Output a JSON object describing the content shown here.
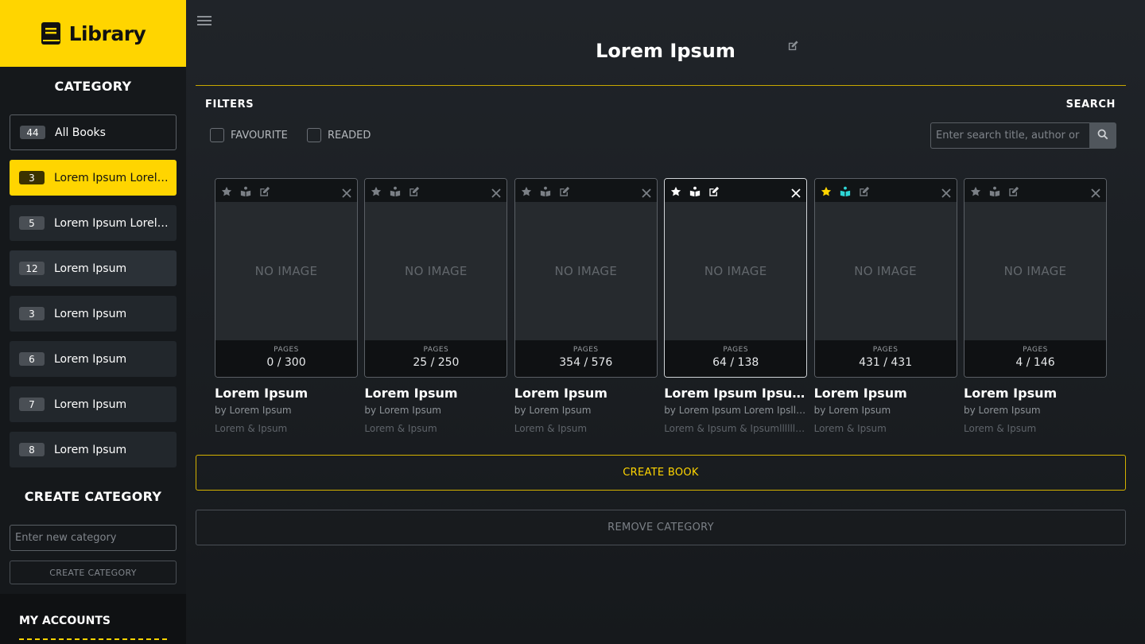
{
  "brand": {
    "title": "Library"
  },
  "sidebar": {
    "category_heading": "CATEGORY",
    "categories": [
      {
        "count": "44",
        "label": "All Books",
        "state": "outlined"
      },
      {
        "count": "3",
        "label": "Lorem Ipsum Lorelllll",
        "state": "active"
      },
      {
        "count": "5",
        "label": "Lorem Ipsum Lorelllll",
        "state": "normal"
      },
      {
        "count": "12",
        "label": "Lorem Ipsum",
        "state": "hovered"
      },
      {
        "count": "3",
        "label": "Lorem Ipsum",
        "state": "normal"
      },
      {
        "count": "6",
        "label": "Lorem Ipsum",
        "state": "normal"
      },
      {
        "count": "7",
        "label": "Lorem Ipsum",
        "state": "normal"
      },
      {
        "count": "8",
        "label": "Lorem Ipsum",
        "state": "normal"
      }
    ],
    "create_heading": "CREATE CATEGORY",
    "new_category_placeholder": "Enter new category",
    "create_button": "CREATE CATEGORY",
    "accounts_heading": "MY ACCOUNTS"
  },
  "main": {
    "title": "Lorem Ipsum",
    "filters_heading": "FILTERS",
    "search_heading": "SEARCH",
    "filter_favourite": "FAVOURITE",
    "filter_readed": "READED",
    "search_placeholder": "Enter search title, author or",
    "create_book_button": "CREATE BOOK",
    "remove_category_button": "REMOVE CATEGORY"
  },
  "colors": {
    "accent": "#ffd500",
    "read_icon_active": "#2ed6d6"
  },
  "books": [
    {
      "cover": "NO IMAGE",
      "pages_label": "PAGES",
      "pages": "0 / 300",
      "title": "Lorem Ipsum",
      "author": "by Lorem Ipsum",
      "tags": "Lorem & Ipsum",
      "favourite": false,
      "read": false,
      "highlight": false
    },
    {
      "cover": "NO IMAGE",
      "pages_label": "PAGES",
      "pages": "25 / 250",
      "title": "Lorem Ipsum",
      "author": "by Lorem Ipsum",
      "tags": "Lorem & Ipsum",
      "favourite": false,
      "read": false,
      "highlight": false
    },
    {
      "cover": "NO IMAGE",
      "pages_label": "PAGES",
      "pages": "354 / 576",
      "title": "Lorem Ipsum",
      "author": "by Lorem Ipsum",
      "tags": "Lorem & Ipsum",
      "favourite": false,
      "read": false,
      "highlight": false
    },
    {
      "cover": "NO IMAGE",
      "pages_label": "PAGES",
      "pages": "64 / 138",
      "title": "Lorem Ipsum Ipsuelllllll",
      "author": "by Lorem Ipsum Lorem Ipslllllllll",
      "tags": "Lorem & Ipsum & Ipsumllllllllllll",
      "favourite": false,
      "read": false,
      "highlight": true
    },
    {
      "cover": "NO IMAGE",
      "pages_label": "PAGES",
      "pages": "431 / 431",
      "title": "Lorem Ipsum",
      "author": "by Lorem Ipsum",
      "tags": "Lorem & Ipsum",
      "favourite": true,
      "read": true,
      "highlight": false
    },
    {
      "cover": "NO IMAGE",
      "pages_label": "PAGES",
      "pages": "4 / 146",
      "title": "Lorem Ipsum",
      "author": "by Lorem Ipsum",
      "tags": "Lorem & Ipsum",
      "favourite": false,
      "read": false,
      "highlight": false
    }
  ]
}
